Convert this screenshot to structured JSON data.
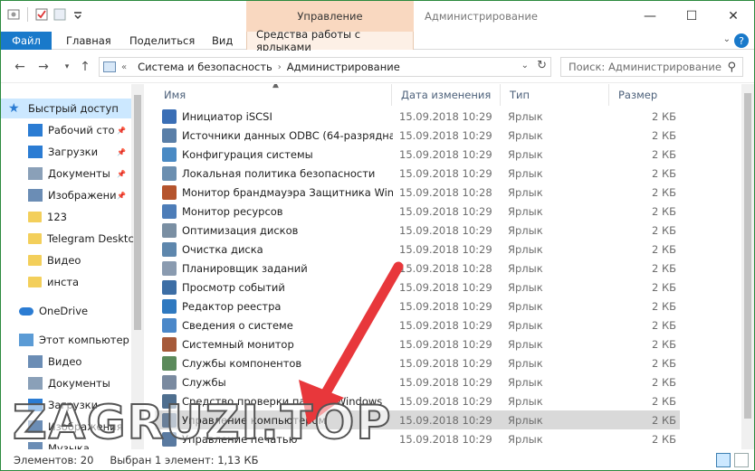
{
  "window": {
    "context_tab_label": "Управление",
    "title": "Администрирование",
    "controls": {
      "minimize": "—",
      "maximize": "☐",
      "close": "✕"
    }
  },
  "ribbon": {
    "tabs": [
      "Файл",
      "Главная",
      "Поделиться",
      "Вид",
      "Средства работы с ярлыками"
    ],
    "file_color": "#1979ca",
    "context_color": "#f9d8c0"
  },
  "address": {
    "segments": [
      "Система и безопасность",
      "Администрирование"
    ],
    "back_icon": "back-arrow-icon",
    "forward_icon": "forward-arrow-icon",
    "up_icon": "up-arrow-icon",
    "search_placeholder": "Поиск: Администрирование"
  },
  "nav": {
    "items": [
      {
        "label": "Быстрый доступ",
        "icon": "star-icon",
        "pinned": false,
        "selected": true
      },
      {
        "label": "Рабочий сто",
        "icon": "desktop-icon",
        "pinned": true
      },
      {
        "label": "Загрузки",
        "icon": "download-icon",
        "pinned": true
      },
      {
        "label": "Документы",
        "icon": "documents-icon",
        "pinned": true
      },
      {
        "label": "Изображени",
        "icon": "pictures-icon",
        "pinned": true
      },
      {
        "label": "123",
        "icon": "folder-icon",
        "pinned": false
      },
      {
        "label": "Telegram Desktc",
        "icon": "folder-icon",
        "pinned": false
      },
      {
        "label": "Видео",
        "icon": "folder-icon",
        "pinned": false
      },
      {
        "label": "инста",
        "icon": "folder-icon",
        "pinned": false
      },
      {
        "label": "OneDrive",
        "icon": "cloud-icon",
        "pinned": false
      },
      {
        "label": "Этот компьютер",
        "icon": "computer-icon",
        "pinned": false
      },
      {
        "label": "Видео",
        "icon": "video-icon",
        "pinned": false
      },
      {
        "label": "Документы",
        "icon": "documents-icon",
        "pinned": false
      },
      {
        "label": "Загрузки",
        "icon": "download-icon",
        "pinned": false
      },
      {
        "label": "Изображения",
        "icon": "pictures-icon",
        "pinned": false
      },
      {
        "label": "Музыка",
        "icon": "music-icon",
        "pinned": false
      }
    ]
  },
  "columns": {
    "name": "Имя",
    "date": "Дата изменения",
    "type": "Тип",
    "size": "Размер"
  },
  "files": [
    {
      "name": "Инициатор iSCSI",
      "date": "15.09.2018 10:29",
      "type": "Ярлык",
      "size": "2 КБ",
      "color": "#3b6fb6"
    },
    {
      "name": "Источники данных ODBC (64-разрядна...",
      "date": "15.09.2018 10:29",
      "type": "Ярлык",
      "size": "2 КБ",
      "color": "#5a7fa8"
    },
    {
      "name": "Конфигурация системы",
      "date": "15.09.2018 10:29",
      "type": "Ярлык",
      "size": "2 КБ",
      "color": "#4a8ac4"
    },
    {
      "name": "Локальная политика безопасности",
      "date": "15.09.2018 10:29",
      "type": "Ярлык",
      "size": "2 КБ",
      "color": "#6c8fb0"
    },
    {
      "name": "Монитор брандмауэра Защитника Win...",
      "date": "15.09.2018 10:28",
      "type": "Ярлык",
      "size": "2 КБ",
      "color": "#b5542d"
    },
    {
      "name": "Монитор ресурсов",
      "date": "15.09.2018 10:29",
      "type": "Ярлык",
      "size": "2 КБ",
      "color": "#4d7db8"
    },
    {
      "name": "Оптимизация дисков",
      "date": "15.09.2018 10:29",
      "type": "Ярлык",
      "size": "2 КБ",
      "color": "#7a8fa3"
    },
    {
      "name": "Очистка диска",
      "date": "15.09.2018 10:29",
      "type": "Ярлык",
      "size": "2 КБ",
      "color": "#5e87ad"
    },
    {
      "name": "Планировщик заданий",
      "date": "15.09.2018 10:28",
      "type": "Ярлык",
      "size": "2 КБ",
      "color": "#8a9bb0"
    },
    {
      "name": "Просмотр событий",
      "date": "15.09.2018 10:29",
      "type": "Ярлык",
      "size": "2 КБ",
      "color": "#3d6ea5"
    },
    {
      "name": "Редактор реестра",
      "date": "15.09.2018 10:29",
      "type": "Ярлык",
      "size": "2 КБ",
      "color": "#2f79c0"
    },
    {
      "name": "Сведения о системе",
      "date": "15.09.2018 10:29",
      "type": "Ярлык",
      "size": "2 КБ",
      "color": "#4b88c9"
    },
    {
      "name": "Системный монитор",
      "date": "15.09.2018 10:29",
      "type": "Ярлык",
      "size": "2 КБ",
      "color": "#a65a3a"
    },
    {
      "name": "Службы компонентов",
      "date": "15.09.2018 10:29",
      "type": "Ярлык",
      "size": "2 КБ",
      "color": "#5b8a5b"
    },
    {
      "name": "Службы",
      "date": "15.09.2018 10:29",
      "type": "Ярлык",
      "size": "2 КБ",
      "color": "#7a8aa0"
    },
    {
      "name": "Средство проверки памяти Windows",
      "date": "15.09.2018 10:29",
      "type": "Ярлык",
      "size": "2 КБ",
      "color": "#4f6f8f"
    },
    {
      "name": "Управление компьютером",
      "date": "15.09.2018 10:29",
      "type": "Ярлык",
      "size": "2 КБ",
      "color": "#6a7f98",
      "selected": true
    },
    {
      "name": "Управление печатью",
      "date": "15.09.2018 10:29",
      "type": "Ярлык",
      "size": "2 КБ",
      "color": "#5a7aa0"
    }
  ],
  "status": {
    "count": "Элементов: 20",
    "selected": "Выбран 1 элемент: 1,13 КБ"
  },
  "watermark": "ZAGRUZI.TOP",
  "arrow_color": "#e8373b"
}
